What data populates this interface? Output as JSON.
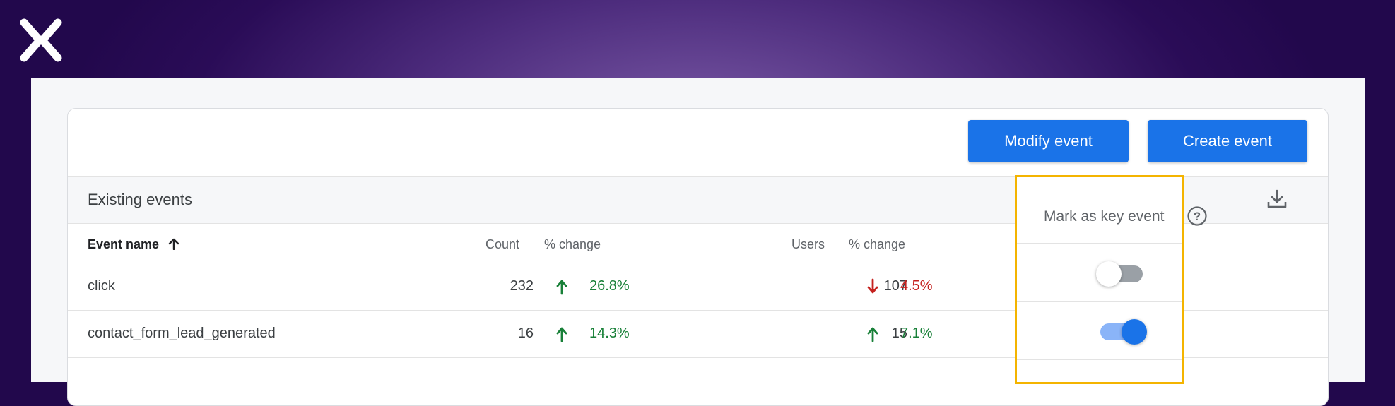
{
  "brand": {
    "logo_icon": "x-logo-icon"
  },
  "toolbar": {
    "modify_label": "Modify event",
    "create_label": "Create event"
  },
  "section": {
    "title": "Existing events",
    "download_icon": "download-icon"
  },
  "table": {
    "headers": {
      "name": "Event name",
      "count": "Count",
      "pct_change_count": "% change",
      "users": "Users",
      "pct_change_users": "% change"
    },
    "sort": "ascending",
    "rows": [
      {
        "name": "click",
        "count": "232",
        "count_change": "26.8%",
        "count_dir": "up",
        "users": "107",
        "users_change": "4.5%",
        "users_dir": "down",
        "key_event": false
      },
      {
        "name": "contact_form_lead_generated",
        "count": "16",
        "count_change": "14.3%",
        "count_dir": "up",
        "users": "15",
        "users_change": "7.1%",
        "users_dir": "up",
        "key_event": true
      }
    ]
  },
  "key_event_column": {
    "label": "Mark as key event",
    "help_icon": "help-icon"
  },
  "colors": {
    "accent": "#1a73e8",
    "up": "#188038",
    "down": "#c5221f",
    "highlight": "#f4b400"
  }
}
